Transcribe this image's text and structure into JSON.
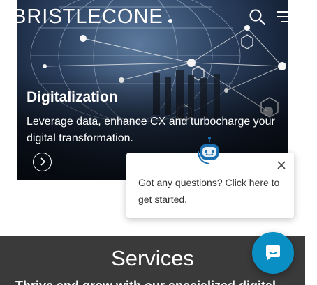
{
  "header": {
    "logo_text": "BRISTLECONE"
  },
  "hero": {
    "title": "Digitalization",
    "description": "Leverage data, enhance CX and turbocharge your digital transformation."
  },
  "services": {
    "title": "Services",
    "subtitle": "Thrive and grow with our specialized digital"
  },
  "chat": {
    "prompt": "Got any questions? Click here to get started."
  },
  "colors": {
    "services_bg": "#3a3a3a",
    "chat_launcher": "#0a8fc4",
    "bot_accent": "#1a6fb0"
  }
}
